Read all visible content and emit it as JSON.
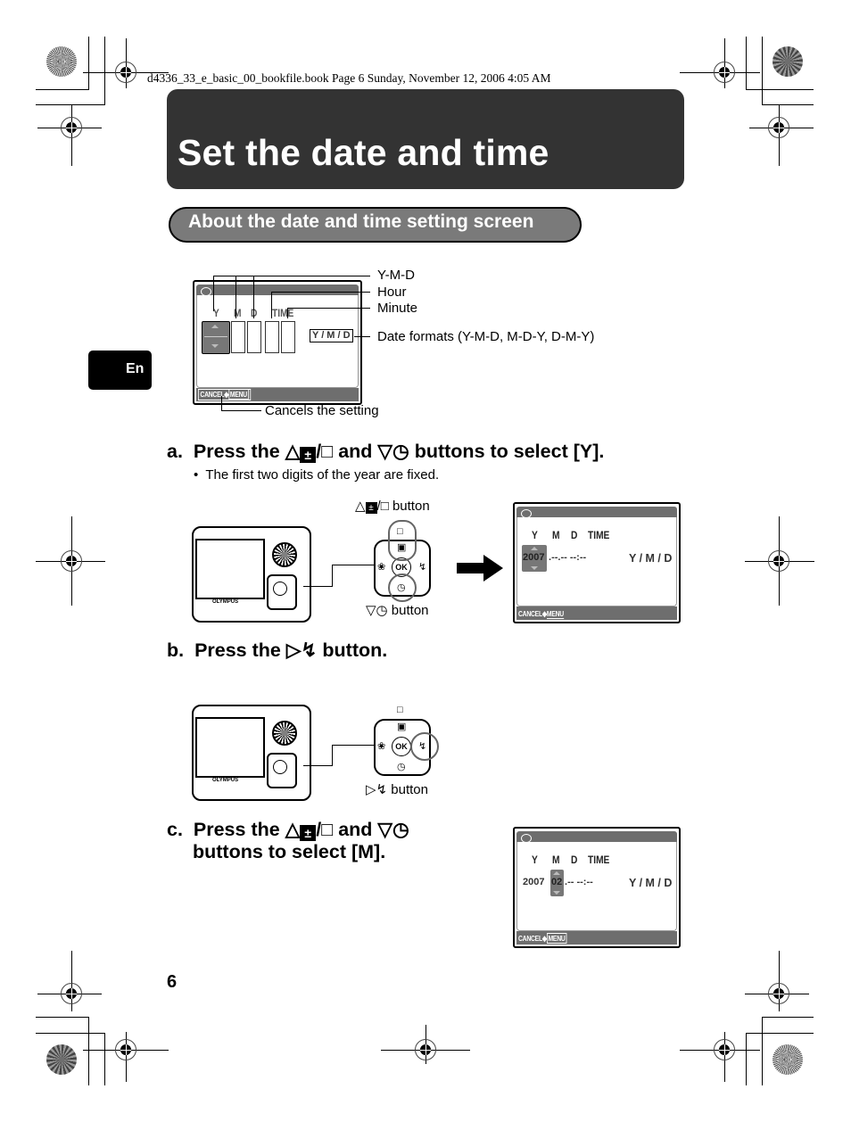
{
  "header": {
    "file_info": "d4336_33_e_basic_00_bookfile.book  Page 6  Sunday, November 12, 2006  4:05 AM"
  },
  "page": {
    "title": "Set the date and time",
    "section_title": "About the date and time setting screen",
    "language_tab": "En",
    "page_number": "6"
  },
  "diagram": {
    "callouts": {
      "ymd": "Y-M-D",
      "hour": "Hour",
      "minute": "Minute",
      "date_formats": "Date formats (Y-M-D, M-D-Y, D-M-Y)",
      "cancels": "Cancels the setting"
    },
    "screen": {
      "headers": [
        "Y",
        "M",
        "D",
        "TIME"
      ],
      "format": "Y / M / D",
      "cancel_label": "CANCEL",
      "menu_label": "MENU"
    }
  },
  "steps": {
    "a": {
      "letter": "a.",
      "text_prefix": "Press the",
      "text_and": "and",
      "text_suffix": "buttons to select [Y].",
      "note": "The first two digits of the year are fixed.",
      "up_button_label": "button",
      "down_button_label": "button",
      "screen": {
        "year": "2007",
        "month": "--",
        "day": "--",
        "time": "--:--",
        "format": "Y / M / D",
        "headers": [
          "Y",
          "M",
          "D",
          "TIME"
        ],
        "cancel_label": "CANCEL",
        "menu_label": "MENU"
      }
    },
    "b": {
      "letter": "b.",
      "text_prefix": "Press the",
      "text_suffix": "button.",
      "right_button_label": "button"
    },
    "c": {
      "letter": "c.",
      "text_prefix": "Press the",
      "text_and": "and",
      "text_line2": "buttons to select [M].",
      "screen": {
        "year": "2007",
        "month": "02",
        "day": "--",
        "time": "--:--",
        "format": "Y / M / D",
        "headers": [
          "Y",
          "M",
          "D",
          "TIME"
        ],
        "cancel_label": "CANCEL",
        "menu_label": "MENU"
      }
    }
  },
  "camera": {
    "brand": "OLYMPUS",
    "ok_label": "OK"
  }
}
